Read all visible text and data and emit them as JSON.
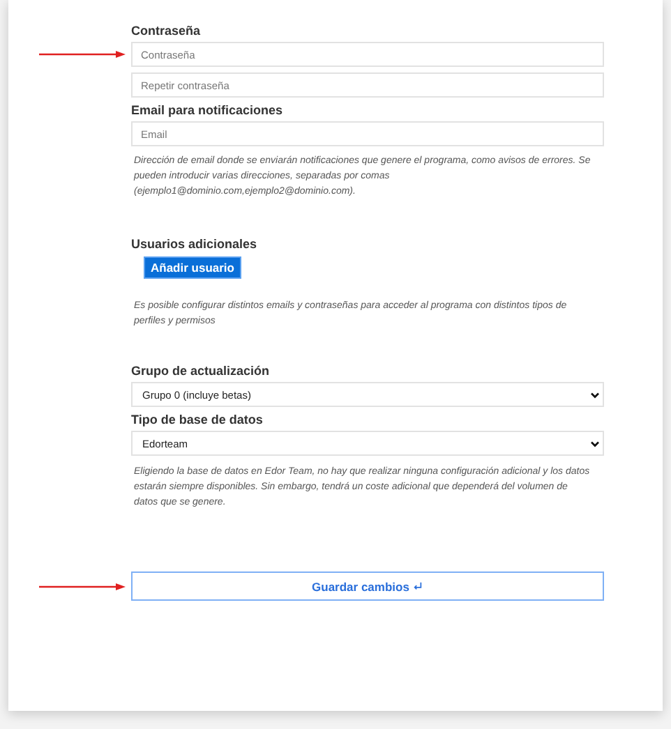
{
  "sections": [
    {
      "kind": "fields",
      "label": "Contraseña",
      "fields": [
        {
          "kind": "input",
          "placeholder": "Contraseña",
          "annotated": true
        },
        {
          "kind": "input",
          "placeholder": "Repetir contraseña"
        }
      ]
    },
    {
      "kind": "fields",
      "label": "Email para notificaciones",
      "fields": [
        {
          "kind": "input",
          "placeholder": "Email"
        }
      ],
      "help": "Dirección de email donde se enviarán notificaciones que genere el programa, como avisos de errores. Se pueden introducir varias direcciones, separadas por comas (ejemplo1@dominio.com,ejemplo2@dominio.com)."
    },
    {
      "kind": "users",
      "label": "Usuarios adicionales",
      "button": "Añadir usuario",
      "help": "Es posible configurar distintos emails y contraseñas para acceder al programa con distintos tipos de perfiles y permisos"
    },
    {
      "kind": "fields",
      "label": "Grupo de actualización",
      "fields": [
        {
          "kind": "select",
          "value": "Grupo 0 (incluye betas)"
        }
      ]
    },
    {
      "kind": "fields",
      "label": "Tipo de base de datos",
      "fields": [
        {
          "kind": "select",
          "value": "Edorteam"
        }
      ],
      "help": "Eligiendo la base de datos en Edor Team, no hay que realizar ninguna configuración adicional y los datos estarán siempre disponibles. Sin embargo, tendrá un coste adicional que dependerá del volumen de datos que se genere."
    }
  ],
  "save_button": {
    "label": "Guardar cambios",
    "annotated": true
  }
}
